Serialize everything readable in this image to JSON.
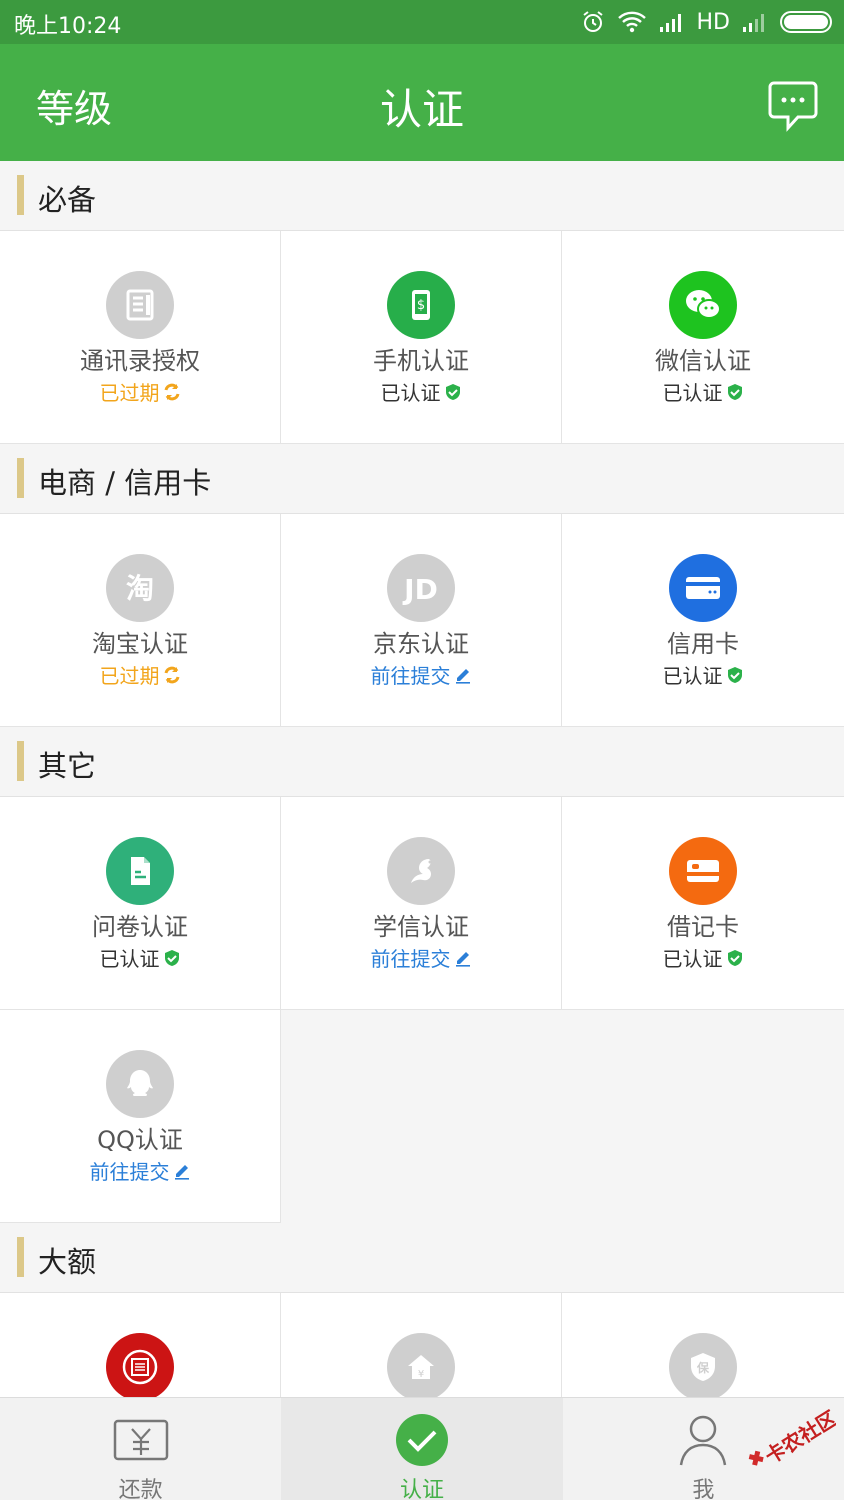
{
  "statusbar": {
    "time": "晚上10:24",
    "network": "HD"
  },
  "appbar": {
    "left_label": "等级",
    "title": "认证"
  },
  "sections": [
    {
      "title": "必备",
      "items": [
        {
          "name": "通讯录授权",
          "status": "已过期",
          "state": "expired",
          "icon": "contacts-icon",
          "color": "#cfcfcf"
        },
        {
          "name": "手机认证",
          "status": "已认证",
          "state": "verified",
          "icon": "phone-icon",
          "color": "#27ae4a"
        },
        {
          "name": "微信认证",
          "status": "已认证",
          "state": "verified",
          "icon": "wechat-icon",
          "color": "#1ec31f"
        }
      ]
    },
    {
      "title": "电商 / 信用卡",
      "items": [
        {
          "name": "淘宝认证",
          "status": "已过期",
          "state": "expired",
          "icon": "taobao-icon",
          "color": "#cfcfcf"
        },
        {
          "name": "京东认证",
          "status": "前往提交",
          "state": "submit",
          "icon": "jd-icon",
          "color": "#cfcfcf"
        },
        {
          "name": "信用卡",
          "status": "已认证",
          "state": "verified",
          "icon": "credit-card-icon",
          "color": "#1f6fe0"
        }
      ]
    },
    {
      "title": "其它",
      "items": [
        {
          "name": "问卷认证",
          "status": "已认证",
          "state": "verified",
          "icon": "questionnaire-icon",
          "color": "#2fb07a"
        },
        {
          "name": "学信认证",
          "status": "前往提交",
          "state": "submit",
          "icon": "chsi-icon",
          "color": "#cfcfcf"
        },
        {
          "name": "借记卡",
          "status": "已认证",
          "state": "verified",
          "icon": "debit-card-icon",
          "color": "#f46a10"
        },
        {
          "name": "QQ认证",
          "status": "前往提交",
          "state": "submit",
          "icon": "qq-icon",
          "color": "#cfcfcf"
        }
      ]
    },
    {
      "title": "大额",
      "items": [
        {
          "icon": "credit-report-icon",
          "color": "#cc1414"
        },
        {
          "icon": "housing-fund-icon",
          "color": "#cfcfcf"
        },
        {
          "icon": "insurance-icon",
          "color": "#cfcfcf"
        }
      ]
    }
  ],
  "tabbar": {
    "tabs": [
      {
        "label": "还款"
      },
      {
        "label": "认证"
      },
      {
        "label": "我"
      }
    ]
  },
  "watermark": {
    "text": "卡农社区"
  }
}
